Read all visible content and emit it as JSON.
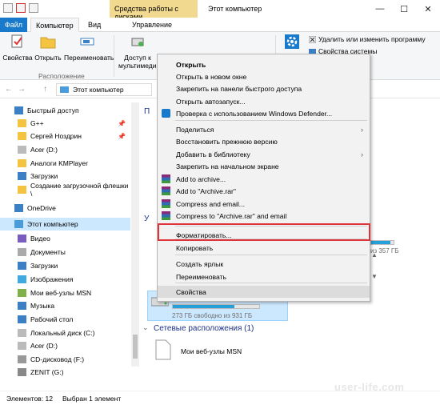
{
  "title_bar": {
    "context_tab": "Средства работы с дисками",
    "window_title": "Этот компьютер",
    "controls": [
      "—",
      "☐",
      "✕"
    ]
  },
  "tabs": [
    "Файл",
    "Компьютер",
    "Вид",
    "Управление"
  ],
  "ribbon": {
    "buttons": [
      "Свойства",
      "Открыть",
      "Переименовать",
      "Доступ к мультимедиа"
    ],
    "group_label": "Расположение",
    "small_buttons": [
      "Удалить или изменить программу",
      "Свойства системы"
    ]
  },
  "address": {
    "path": "Этот компьютер",
    "back": "←",
    "forward": "→",
    "up": "↑"
  },
  "nav": {
    "items": [
      {
        "label": "Быстрый доступ",
        "icon": "star-icon",
        "pinned": false
      },
      {
        "label": "G++",
        "icon": "folder-icon",
        "pinned": true
      },
      {
        "label": "Сергей Ноздрин",
        "icon": "folder-icon",
        "pinned": true
      },
      {
        "label": "Acer (D:)",
        "icon": "drive-icon",
        "pinned": false
      },
      {
        "label": "Аналоги KMPlayer",
        "icon": "folder-icon",
        "pinned": false
      },
      {
        "label": "Загрузки",
        "icon": "downloads-icon",
        "pinned": false
      },
      {
        "label": "Создание загрузочной флешки \\",
        "icon": "folder-icon",
        "pinned": false
      },
      {
        "label": "OneDrive",
        "icon": "cloud-icon",
        "pinned": false
      },
      {
        "label": "Этот компьютер",
        "icon": "computer-icon",
        "pinned": false
      },
      {
        "label": "Видео",
        "icon": "video-icon",
        "pinned": false
      },
      {
        "label": "Документы",
        "icon": "documents-icon",
        "pinned": false
      },
      {
        "label": "Загрузки",
        "icon": "downloads-icon",
        "pinned": false
      },
      {
        "label": "Изображения",
        "icon": "pictures-icon",
        "pinned": false
      },
      {
        "label": "Мои веб-узлы MSN",
        "icon": "web-icon",
        "pinned": false
      },
      {
        "label": "Музыка",
        "icon": "music-icon",
        "pinned": false
      },
      {
        "label": "Рабочий стол",
        "icon": "desktop-icon",
        "pinned": false
      },
      {
        "label": "Локальный диск (C:)",
        "icon": "drive-icon",
        "pinned": false
      },
      {
        "label": "Acer (D:)",
        "icon": "drive-icon",
        "pinned": false
      },
      {
        "label": "CD-дисковод (F:)",
        "icon": "cd-icon",
        "pinned": false
      },
      {
        "label": "ZENIT (G:)",
        "icon": "usb-icon",
        "pinned": false
      }
    ],
    "pin_glyph": "📌"
  },
  "content": {
    "section_devices_letter_1": "П",
    "section_devices_letter_2": "У",
    "drive_partial_label": "из 357 ГБ",
    "selected_drive_label": "273 ГБ свободно из 931 ГБ",
    "selected_drive_fill": 0.71,
    "other_drive_fill": 0.85,
    "network_section": "Сетевые расположения (1)",
    "network_item": "Мои веб-узлы MSN"
  },
  "context_menu": {
    "items": [
      {
        "label": "Открыть",
        "bold": true,
        "icon": null,
        "submenu": false
      },
      {
        "label": "Открыть в новом окне",
        "bold": false,
        "icon": null,
        "submenu": false
      },
      {
        "label": "Закрепить на панели быстрого доступа",
        "bold": false,
        "icon": null,
        "submenu": false
      },
      {
        "label": "Открыть автозапуск...",
        "bold": false,
        "icon": null,
        "submenu": false
      },
      {
        "label": "Проверка с использованием Windows Defender...",
        "bold": false,
        "icon": "defender-icon",
        "submenu": false
      },
      {
        "label": "Поделиться",
        "bold": false,
        "icon": null,
        "submenu": true
      },
      {
        "label": "Восстановить прежнюю версию",
        "bold": false,
        "icon": null,
        "submenu": false
      },
      {
        "label": "Добавить в библиотеку",
        "bold": false,
        "icon": null,
        "submenu": true
      },
      {
        "label": "Закрепить на начальном экране",
        "bold": false,
        "icon": null,
        "submenu": false
      },
      {
        "label": "Add to archive...",
        "bold": false,
        "icon": "winrar-icon",
        "submenu": false
      },
      {
        "label": "Add to \"Archive.rar\"",
        "bold": false,
        "icon": "winrar-icon",
        "submenu": false
      },
      {
        "label": "Compress and email...",
        "bold": false,
        "icon": "winrar-icon",
        "submenu": false
      },
      {
        "label": "Compress to \"Archive.rar\" and email",
        "bold": false,
        "icon": "winrar-icon",
        "submenu": false
      },
      {
        "label": "Форматировать...",
        "bold": false,
        "icon": null,
        "submenu": false
      },
      {
        "label": "Копировать",
        "bold": false,
        "icon": null,
        "submenu": false
      },
      {
        "label": "Создать ярлык",
        "bold": false,
        "icon": null,
        "submenu": false
      },
      {
        "label": "Переименовать",
        "bold": false,
        "icon": null,
        "submenu": false
      },
      {
        "label": "Свойства",
        "bold": false,
        "icon": null,
        "submenu": false
      }
    ],
    "submenu_glyph": "›"
  },
  "status": {
    "count": "Элементов: 12",
    "selected": "Выбран 1 элемент"
  },
  "watermark": "user-life.com",
  "colors": {
    "accent": "#1979ca",
    "context_tab": "#f1d98f",
    "selection": "#cce8ff",
    "highlight": "#e0343b",
    "drive_bar": "#26a0da"
  }
}
